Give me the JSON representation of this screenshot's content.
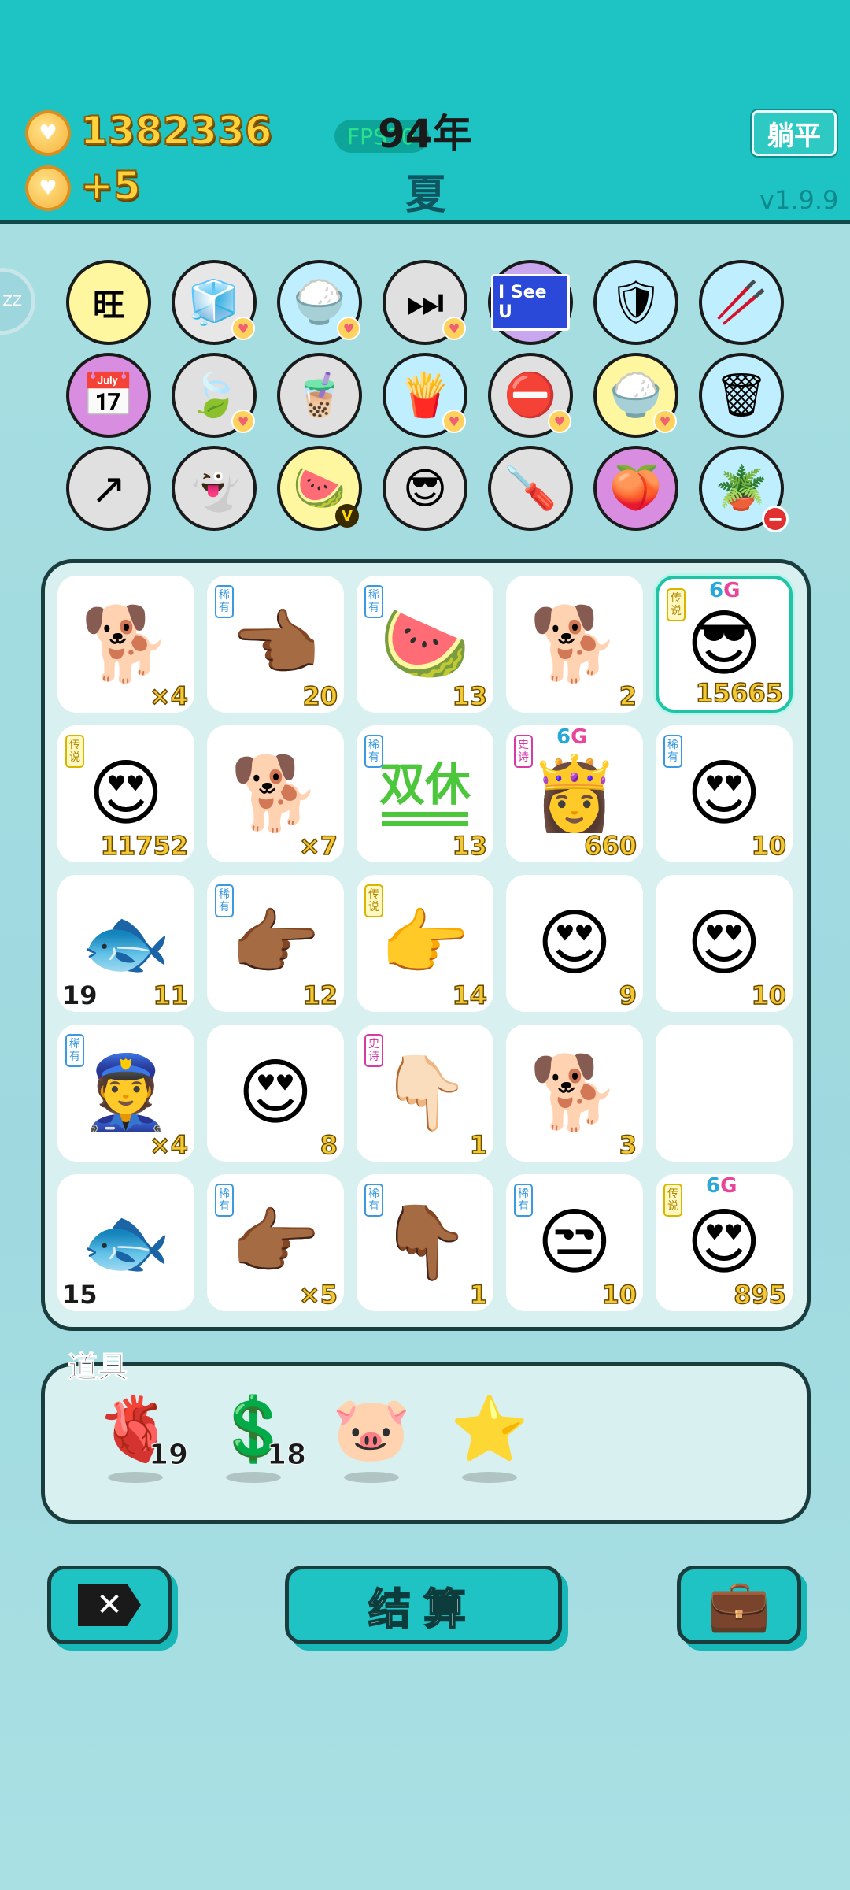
{
  "header": {
    "coins": "1382336",
    "income": "+5",
    "year": "94年",
    "fps": "FPS30",
    "season": "夏",
    "lie_flat_label": "躺平",
    "version": "v1.9.9",
    "zz_label": "ZZ"
  },
  "skills": [
    {
      "icon": "wang-icon",
      "glyph": "旺",
      "badge": "none"
    },
    {
      "icon": "sugar-cubes-icon",
      "glyph": "🧊",
      "badge": "heart"
    },
    {
      "icon": "rice-bowl-icon",
      "glyph": "🍚",
      "badge": "heart"
    },
    {
      "icon": "skip-icon",
      "glyph": "⏭",
      "badge": "heart"
    },
    {
      "icon": "i-see-u-icon",
      "glyph": "I See U",
      "badge": "none"
    },
    {
      "icon": "shield-wrench-icon",
      "glyph": "🛡",
      "badge": "none"
    },
    {
      "icon": "chopsticks-icon",
      "glyph": "🥢",
      "badge": "none"
    },
    {
      "icon": "calendar-icon",
      "glyph": "📅",
      "badge": "none"
    },
    {
      "icon": "leaf-icon",
      "glyph": "🍃",
      "badge": "heart"
    },
    {
      "icon": "bubble-tea-icon",
      "glyph": "🧋",
      "badge": "none"
    },
    {
      "icon": "fries-icon",
      "glyph": "🍟",
      "badge": "heart"
    },
    {
      "icon": "no-entry-icon",
      "glyph": "⛔",
      "badge": "heart"
    },
    {
      "icon": "rice-bowl-icon",
      "glyph": "🍚",
      "badge": "heart"
    },
    {
      "icon": "trash-bag-icon",
      "glyph": "🗑",
      "badge": "none"
    },
    {
      "icon": "arrow-up-icon",
      "glyph": "↗",
      "badge": "none"
    },
    {
      "icon": "ghost-icon",
      "glyph": "👻",
      "badge": "none"
    },
    {
      "icon": "fruit-plate-icon",
      "glyph": "🍉",
      "badge": "v"
    },
    {
      "icon": "sunglasses-face-icon",
      "glyph": "😎",
      "badge": "none"
    },
    {
      "icon": "screwdriver-icon",
      "glyph": "🪛",
      "badge": "none"
    },
    {
      "icon": "peach-sunglasses-icon",
      "glyph": "🍑",
      "badge": "none"
    },
    {
      "icon": "potted-flower-icon",
      "glyph": "🪴",
      "badge": "minus"
    }
  ],
  "grid": [
    {
      "icon": "husky-icon",
      "glyph": "🐕",
      "count": "×4",
      "rarity": "",
      "rarity_class": "",
      "six_g": false,
      "left_count": ""
    },
    {
      "icon": "pointing-hand-left-icon",
      "glyph": "👈🏾",
      "count": "20",
      "rarity": "稀有",
      "rarity_class": "r-blue",
      "six_g": false,
      "left_count": ""
    },
    {
      "icon": "watermelon-icon",
      "glyph": "🍉",
      "count": "13",
      "rarity": "稀有",
      "rarity_class": "r-blue",
      "six_g": false,
      "left_count": ""
    },
    {
      "icon": "husky-icon",
      "glyph": "🐕",
      "count": "2",
      "rarity": "",
      "rarity_class": "",
      "six_g": false,
      "left_count": ""
    },
    {
      "icon": "sunglasses-man-icon",
      "glyph": "😎",
      "count": "15665",
      "rarity": "传说",
      "rarity_class": "r-gold",
      "six_g": true,
      "left_count": ""
    },
    {
      "icon": "heart-eyes-man-icon",
      "glyph": "😍",
      "count": "11752",
      "rarity": "传说",
      "rarity_class": "r-gold",
      "six_g": false,
      "left_count": ""
    },
    {
      "icon": "husky-icon",
      "glyph": "🐕",
      "count": "×7",
      "rarity": "",
      "rarity_class": "",
      "six_g": false,
      "left_count": ""
    },
    {
      "icon": "double-rest-icon",
      "glyph": "双休",
      "count": "13",
      "rarity": "稀有",
      "rarity_class": "r-blue",
      "six_g": false,
      "left_count": ""
    },
    {
      "icon": "crowned-girl-icon",
      "glyph": "👸",
      "count": "660",
      "rarity": "史诗",
      "rarity_class": "r-pink",
      "six_g": true,
      "left_count": ""
    },
    {
      "icon": "bucket-hat-heart-eyes-icon",
      "glyph": "😍",
      "count": "10",
      "rarity": "稀有",
      "rarity_class": "r-blue",
      "six_g": false,
      "left_count": ""
    },
    {
      "icon": "fish-icon",
      "glyph": "🐟",
      "count": "11",
      "rarity": "",
      "rarity_class": "",
      "six_g": false,
      "left_count": "19"
    },
    {
      "icon": "pointing-hand-icon",
      "glyph": "👉🏾",
      "count": "12",
      "rarity": "稀有",
      "rarity_class": "r-blue",
      "six_g": false,
      "left_count": ""
    },
    {
      "icon": "yellow-pointing-hand-icon",
      "glyph": "👉",
      "count": "14",
      "rarity": "传说",
      "rarity_class": "r-gold",
      "six_g": false,
      "left_count": ""
    },
    {
      "icon": "cap-grandpa-icon",
      "glyph": "😍",
      "count": "9",
      "rarity": "",
      "rarity_class": "",
      "six_g": false,
      "left_count": ""
    },
    {
      "icon": "cap-grandpa-icon",
      "glyph": "😍",
      "count": "10",
      "rarity": "",
      "rarity_class": "",
      "six_g": false,
      "left_count": ""
    },
    {
      "icon": "police-icon",
      "glyph": "👮",
      "count": "×4",
      "rarity": "稀有",
      "rarity_class": "r-blue",
      "six_g": false,
      "left_count": ""
    },
    {
      "icon": "cap-grandpa-icon",
      "glyph": "😍",
      "count": "8",
      "rarity": "",
      "rarity_class": "",
      "six_g": false,
      "left_count": ""
    },
    {
      "icon": "gray-pointing-hand-icon",
      "glyph": "👇🏻",
      "count": "1",
      "rarity": "史诗",
      "rarity_class": "r-pink",
      "six_g": false,
      "left_count": ""
    },
    {
      "icon": "husky-icon",
      "glyph": "🐕",
      "count": "3",
      "rarity": "",
      "rarity_class": "",
      "six_g": false,
      "left_count": ""
    },
    {
      "icon": "empty-slot-icon",
      "glyph": "",
      "count": "",
      "rarity": "",
      "rarity_class": "",
      "six_g": false,
      "left_count": ""
    },
    {
      "icon": "fish-icon",
      "glyph": "🐟",
      "count": "",
      "rarity": "",
      "rarity_class": "",
      "six_g": false,
      "left_count": "15"
    },
    {
      "icon": "pointing-hand-icon",
      "glyph": "👉🏾",
      "count": "×5",
      "rarity": "稀有",
      "rarity_class": "r-blue",
      "six_g": false,
      "left_count": ""
    },
    {
      "icon": "pointing-down-hand-icon",
      "glyph": "👇🏾",
      "count": "1",
      "rarity": "稀有",
      "rarity_class": "r-blue",
      "six_g": false,
      "left_count": ""
    },
    {
      "icon": "bucket-hat-man-icon",
      "glyph": "😒",
      "count": "10",
      "rarity": "稀有",
      "rarity_class": "r-blue",
      "six_g": false,
      "left_count": ""
    },
    {
      "icon": "heart-eyes-man-icon",
      "glyph": "😍",
      "count": "895",
      "rarity": "传说",
      "rarity_class": "r-gold",
      "six_g": true,
      "left_count": ""
    }
  ],
  "six_g": {
    "six": "6",
    "g": "G"
  },
  "props": {
    "label": "道具",
    "items": [
      {
        "icon": "liver-icon",
        "glyph": "🫀",
        "count": "19"
      },
      {
        "icon": "dollar-coin-icon",
        "glyph": "💲",
        "count": "18"
      },
      {
        "icon": "piggy-bank-icon",
        "glyph": "🐷",
        "count": ""
      },
      {
        "icon": "star-icon",
        "glyph": "⭐",
        "count": ""
      }
    ]
  },
  "buttons": {
    "close_glyph": "✕",
    "settle_label": "结算",
    "bag_glyph": "💼"
  }
}
